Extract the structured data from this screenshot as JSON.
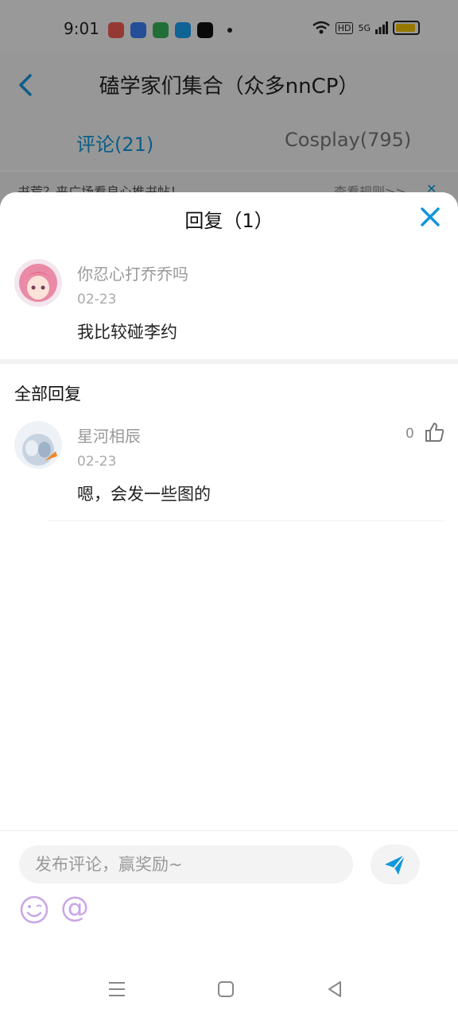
{
  "status_bar": {
    "time": "9:01",
    "app_icons": [
      "music-icon",
      "baidu-icon",
      "app-icon",
      "alipay-icon",
      "tiktok-icon"
    ],
    "indicators": [
      "wifi-icon",
      "hd-icon",
      "signal-5g-icon",
      "battery-icon"
    ],
    "hd_label": "HD",
    "network_label": "5G"
  },
  "header": {
    "title": "磕学家们集合（众多nnCP）"
  },
  "tabs": [
    {
      "label": "评论(21)",
      "active": true
    },
    {
      "label": "Cosplay(795)",
      "active": false
    }
  ],
  "banner": {
    "text": "书荒？来广场看良心推书帖！",
    "link": "查看规则>>"
  },
  "sheet": {
    "title": "回复（1）",
    "original_comment": {
      "username": "你忍心打乔乔吗",
      "date": "02-23",
      "text": "我比较碰李约"
    },
    "section_title": "全部回复",
    "replies": [
      {
        "username": "星河相辰",
        "date": "02-23",
        "text": "嗯，会发一些图的",
        "likes": "0"
      }
    ]
  },
  "composer": {
    "placeholder": "发布评论，赢奖励~",
    "at_symbol": "@"
  },
  "colors": {
    "accent": "#1296db",
    "emoji_purple": "#c9a6e6",
    "battery": "#f2c200"
  }
}
